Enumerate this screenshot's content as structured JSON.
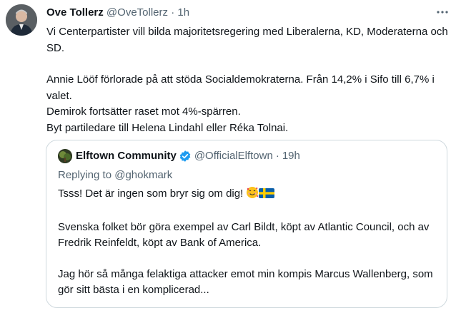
{
  "tweet": {
    "author_name": "Ove Tollerz",
    "author_handle": "@OveTollerz",
    "separator": "·",
    "time": "1h",
    "paragraphs": [
      "Vi Centerpartister vill bilda majoritetsregering med Liberalerna, KD, Moderaterna och SD.",
      "Annie Lööf förlorade på att stöda Socialdemokraterna. Från 14,2% i Sifo till 6,7% i valet.",
      "Demirok fortsätter raset mot 4%-spärren.",
      "Byt partiledare till Helena Lindahl eller Réka Tolnai."
    ]
  },
  "quoted": {
    "author_name": "Elftown Community",
    "author_handle": "@OfficialElftown",
    "separator": "·",
    "time": "19h",
    "reply_prefix": "Replying to",
    "reply_to": "@ghokmark",
    "line1": "Tsss! Det är ingen som bryr sig om dig!",
    "emojis": [
      "smiling-face-with-hearts",
      "sweden-flag"
    ],
    "para2": "Svenska folket bör göra exempel av Carl Bildt, köpt av Atlantic Council, och av Fredrik Reinfeldt, köpt av Bank of America.",
    "para3": "Jag hör så många felaktiga attacker emot min kompis Marcus Wallenberg, som gör sitt bästa i en komplicerad..."
  },
  "colors": {
    "text": "#0f1419",
    "secondary": "#536471",
    "border": "#cfd9de",
    "verified": "#1d9bf0"
  }
}
